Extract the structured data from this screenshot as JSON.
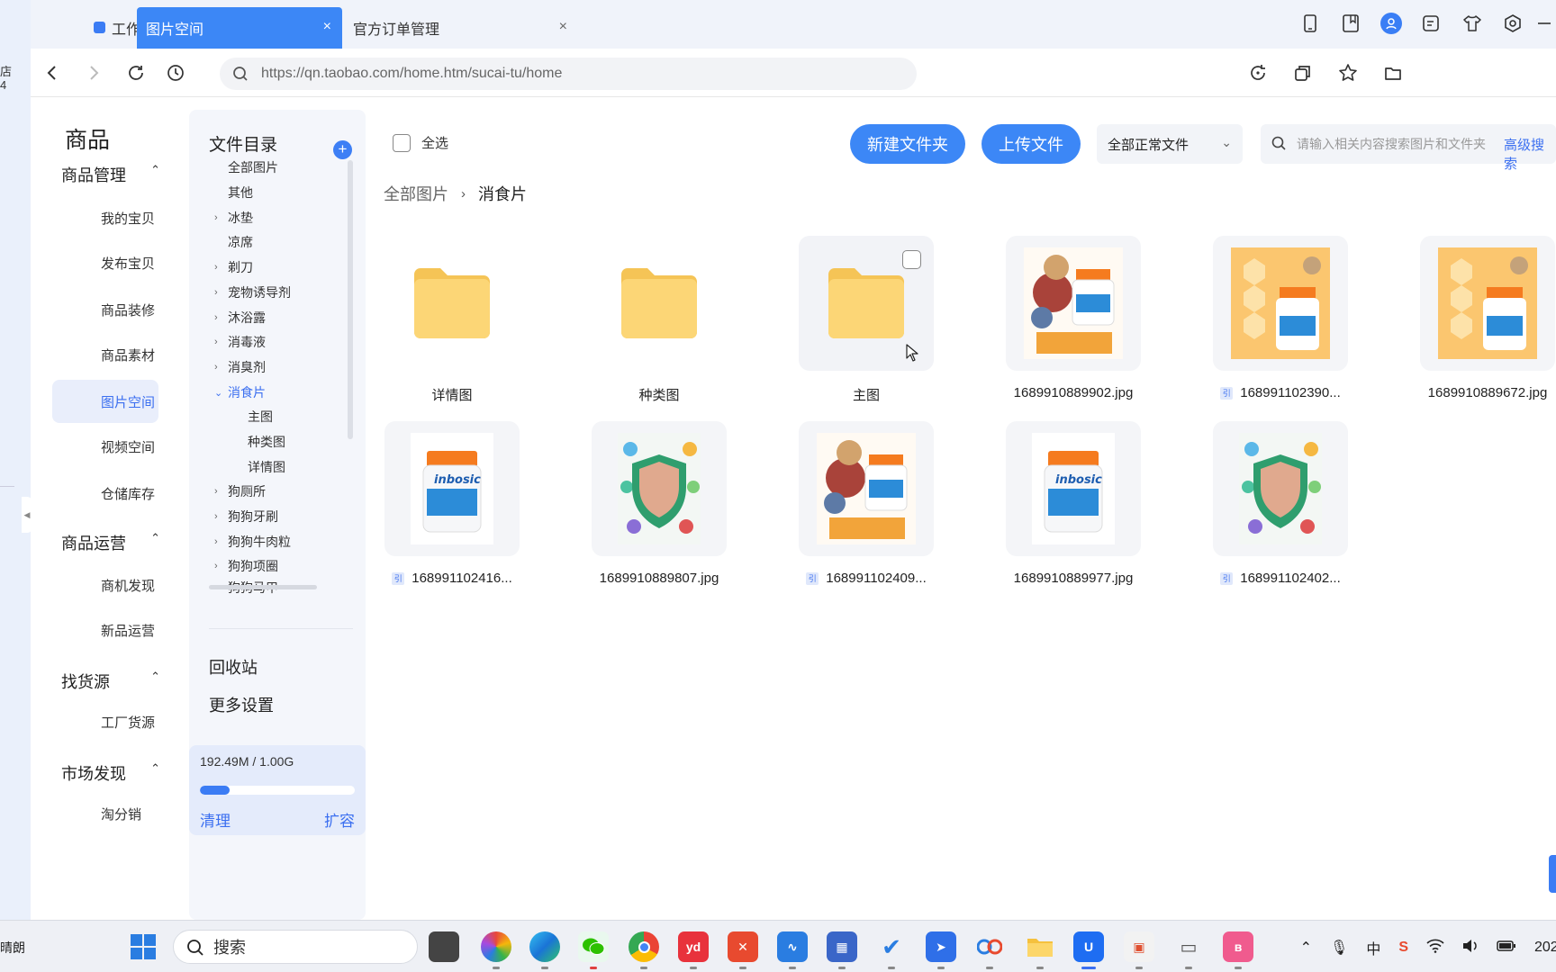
{
  "left_strip": {
    "shop_text": "店\n4"
  },
  "tabs": [
    {
      "label": "工作台"
    },
    {
      "label": "图片空间",
      "close": "×"
    },
    {
      "label": "官方订单管理",
      "close": "×"
    }
  ],
  "nav": {
    "url": "https://qn.taobao.com/home.htm/sucai-tu/home"
  },
  "side_menu": {
    "title": "商品",
    "groups": [
      {
        "label": "商品管理",
        "items": [
          "我的宝贝",
          "发布宝贝",
          "商品装修",
          "商品素材",
          "图片空间",
          "视频空间",
          "仓储库存"
        ]
      },
      {
        "label": "商品运营",
        "items": [
          "商机发现",
          "新品运营"
        ]
      },
      {
        "label": "找货源",
        "items": [
          "工厂货源"
        ]
      },
      {
        "label": "市场发现",
        "items": [
          "淘分销"
        ]
      }
    ],
    "active_item": "图片空间"
  },
  "tree": {
    "header": "文件目录",
    "items": [
      {
        "label": "全部图片",
        "level": 0,
        "arrow": ""
      },
      {
        "label": "其他",
        "level": 0,
        "arrow": ""
      },
      {
        "label": "冰垫",
        "level": 0,
        "arrow": "›"
      },
      {
        "label": "凉席",
        "level": 0,
        "arrow": ""
      },
      {
        "label": "剃刀",
        "level": 0,
        "arrow": "›"
      },
      {
        "label": "宠物诱导剂",
        "level": 0,
        "arrow": "›"
      },
      {
        "label": "沐浴露",
        "level": 0,
        "arrow": "›"
      },
      {
        "label": "消毒液",
        "level": 0,
        "arrow": "›"
      },
      {
        "label": "消臭剂",
        "level": 0,
        "arrow": "›"
      },
      {
        "label": "消食片",
        "level": 0,
        "arrow": "⌄",
        "open": true
      },
      {
        "label": "主图",
        "level": 1,
        "arrow": ""
      },
      {
        "label": "种类图",
        "level": 1,
        "arrow": ""
      },
      {
        "label": "详情图",
        "level": 1,
        "arrow": ""
      },
      {
        "label": "狗厕所",
        "level": 0,
        "arrow": "›"
      },
      {
        "label": "狗狗牙刷",
        "level": 0,
        "arrow": "›"
      },
      {
        "label": "狗狗牛肉粒",
        "level": 0,
        "arrow": "›"
      },
      {
        "label": "狗狗项圈",
        "level": 0,
        "arrow": "›"
      },
      {
        "label": "狗狗马甲",
        "level": 0,
        "arrow": "›"
      }
    ],
    "recycle": "回收站",
    "more_settings": "更多设置"
  },
  "storage": {
    "usage": "192.49M / 1.00G",
    "used_fraction": 0.19,
    "clean": "清理",
    "expand": "扩容"
  },
  "toolbar": {
    "select_all": "全选",
    "new_folder": "新建文件夹",
    "upload": "上传文件",
    "filter": "全部正常文件",
    "search_placeholder": "请输入相关内容搜索图片和文件夹",
    "advanced_search": "高级搜索"
  },
  "breadcrumb": [
    "全部图片",
    "消食片"
  ],
  "files": [
    {
      "name": "详情图",
      "kind": "folder"
    },
    {
      "name": "种类图",
      "kind": "folder"
    },
    {
      "name": "主图",
      "kind": "folder"
    },
    {
      "name": "1689910889902.jpg",
      "kind": "image",
      "ref": false
    },
    {
      "name": "168991102390...",
      "kind": "image",
      "ref": true
    },
    {
      "name": "1689910889672.jpg",
      "kind": "image",
      "ref": false
    },
    {
      "name": "168991102416...",
      "kind": "image",
      "ref": true
    },
    {
      "name": "1689910889807.jpg",
      "kind": "image",
      "ref": false
    },
    {
      "name": "168991102409...",
      "kind": "image",
      "ref": true
    },
    {
      "name": "1689910889977.jpg",
      "kind": "image",
      "ref": false
    },
    {
      "name": "168991102402...",
      "kind": "image",
      "ref": true
    }
  ],
  "ref_badge": "引",
  "taskbar": {
    "weather": "晴朗",
    "search": "搜索",
    "ime": "中",
    "clock": "202"
  },
  "colors": {
    "primary": "#3c87f6",
    "folder": "#f9cf6c",
    "active_bg": "#e9eefb"
  }
}
